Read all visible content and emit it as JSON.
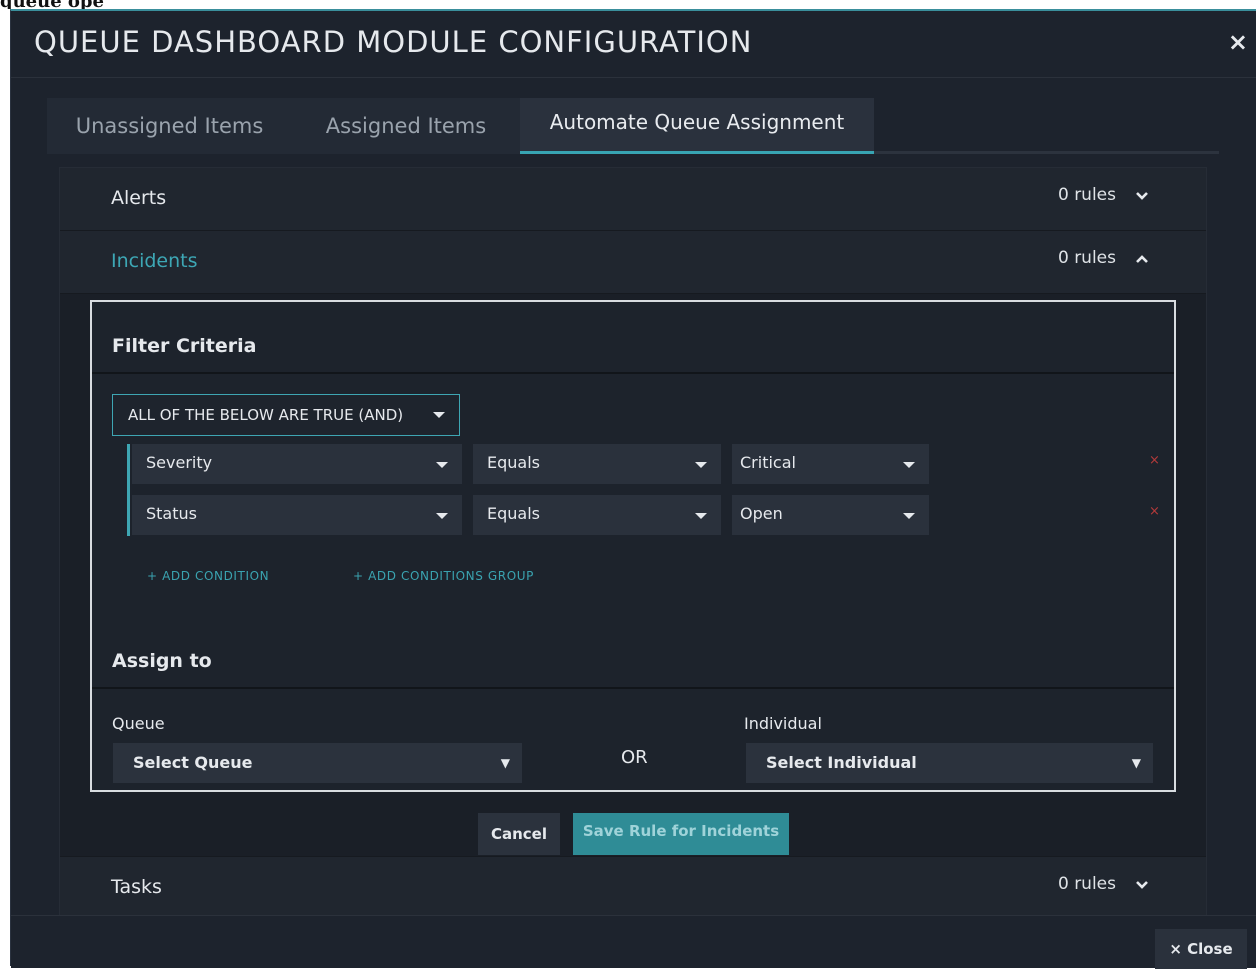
{
  "page_header_text": "queue ope",
  "modal": {
    "title": "QUEUE DASHBOARD MODULE CONFIGURATION",
    "close_icon": "×"
  },
  "tabs": [
    {
      "label": "Unassigned Items",
      "active": false
    },
    {
      "label": "Assigned Items",
      "active": false
    },
    {
      "label": "Automate Queue Assignment",
      "active": true
    }
  ],
  "accordion": {
    "alerts": {
      "label": "Alerts",
      "rules": "0 rules",
      "expanded": false
    },
    "incidents": {
      "label": "Incidents",
      "rules": "0 rules",
      "expanded": true
    },
    "tasks": {
      "label": "Tasks",
      "rules": "0 rules",
      "expanded": false
    }
  },
  "filter": {
    "title": "Filter Criteria",
    "logic": "ALL OF THE BELOW ARE TRUE (AND)",
    "conditions": [
      {
        "field": "Severity",
        "operator": "Equals",
        "value": "Critical"
      },
      {
        "field": "Status",
        "operator": "Equals",
        "value": "Open"
      }
    ],
    "delete_icon": "×",
    "add_condition": "+ ADD CONDITION",
    "add_group": "+ ADD CONDITIONS GROUP"
  },
  "assign": {
    "title": "Assign to",
    "queue_label": "Queue",
    "queue_value": "Select Queue",
    "or_text": "OR",
    "individual_label": "Individual",
    "individual_value": "Select Individual",
    "dropdown_icon": "▼"
  },
  "actions": {
    "cancel": "Cancel",
    "save": "Save Rule for Incidents"
  },
  "footer": {
    "close": "× Close"
  },
  "colors": {
    "accent": "#3ea6b3",
    "background": "#1d232d",
    "danger": "#b33a3a"
  }
}
